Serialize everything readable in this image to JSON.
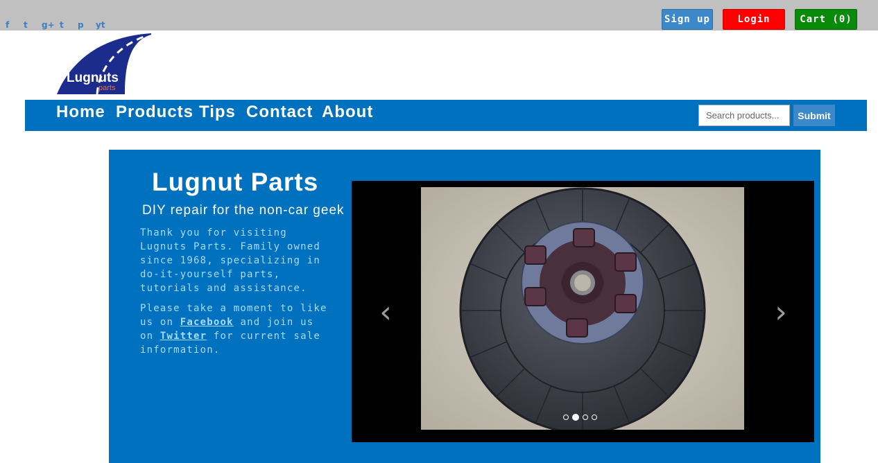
{
  "social": {
    "icons": [
      {
        "name": "facebook-icon",
        "glyph": "f"
      },
      {
        "name": "twitter-icon",
        "glyph": "t"
      },
      {
        "name": "google-plus-icon",
        "glyph": "g+"
      },
      {
        "name": "tumblr-icon",
        "glyph": "t"
      },
      {
        "name": "pinterest-icon",
        "glyph": "p"
      },
      {
        "name": "youtube-icon",
        "glyph": "yt"
      }
    ]
  },
  "header": {
    "signup_label": "Sign up",
    "login_label": "Login",
    "cart_label": "Cart (0)"
  },
  "logo": {
    "text": "Lugnuts",
    "subtext": "parts"
  },
  "nav": {
    "items": [
      "Home",
      "Products",
      "Tips",
      "Contact",
      "About"
    ],
    "search_placeholder": "Search products...",
    "submit_label": "Submit"
  },
  "hero": {
    "title": "Lugnut Parts",
    "subtitle": "DIY repair for the non-car geek",
    "para1": "Thank you for visiting Lugnuts Parts. Family owned since 1968, specializing in do-it-yourself parts, tutorials and assistance.",
    "para2_pre": "Please take a moment to like us on ",
    "facebook_link": "Facebook",
    "para2_mid": " and join us on ",
    "twitter_link": "Twitter",
    "para2_post": " for current sale information."
  },
  "carousel": {
    "prev_glyph": "‹",
    "next_glyph": "›",
    "slide_count": 4,
    "active_slide": 2,
    "image_subject": "clutch-disc"
  },
  "colors": {
    "brand_blue": "#0071bf",
    "signup": "#3d88c9",
    "login": "#ff0000",
    "cart": "#0a8a0a",
    "hero_text": "#a9dcff"
  }
}
